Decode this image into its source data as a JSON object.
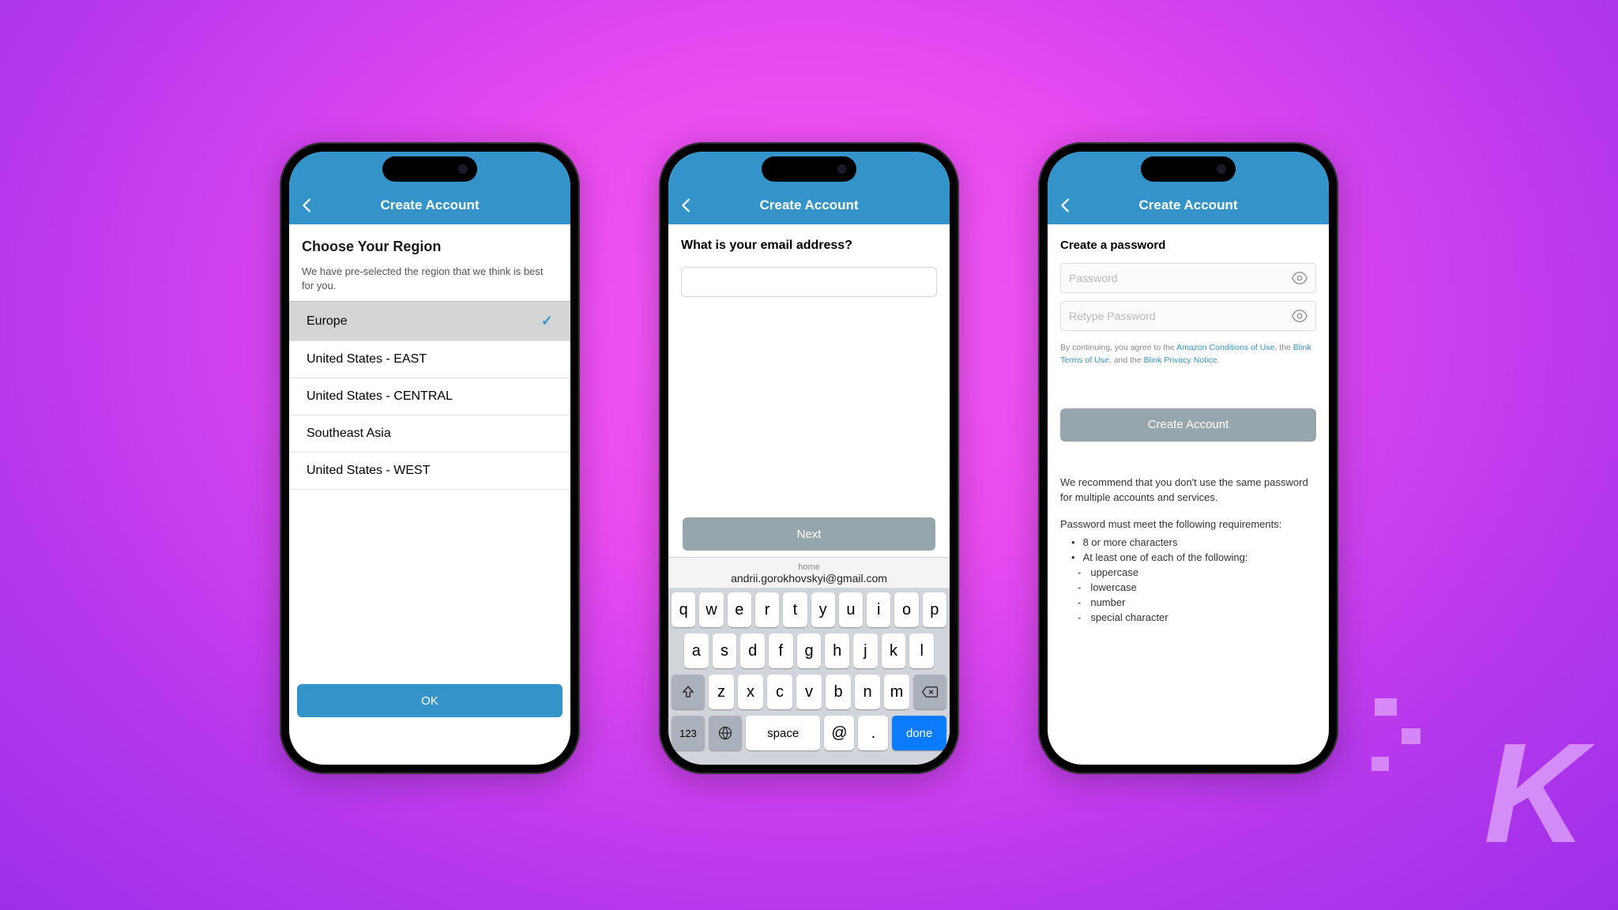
{
  "phone1": {
    "header_title": "Create Account",
    "h1": "Choose Your Region",
    "subtext": "We have pre-selected the region that we think is best for you.",
    "regions": [
      {
        "label": "Europe",
        "selected": true
      },
      {
        "label": "United States - EAST",
        "selected": false
      },
      {
        "label": "United States - CENTRAL",
        "selected": false
      },
      {
        "label": "Southeast Asia",
        "selected": false
      },
      {
        "label": "United States - WEST",
        "selected": false
      }
    ],
    "ok_label": "OK"
  },
  "phone2": {
    "header_title": "Create Account",
    "prompt": "What is your email address?",
    "email_value": "",
    "suggestion_label": "home",
    "suggestion_value": "andrii.gorokhovskyi@gmail.com",
    "next_label": "Next",
    "keyboard": {
      "row1": [
        "q",
        "w",
        "e",
        "r",
        "t",
        "y",
        "u",
        "i",
        "o",
        "p"
      ],
      "row2": [
        "a",
        "s",
        "d",
        "f",
        "g",
        "h",
        "j",
        "k",
        "l"
      ],
      "row3": [
        "z",
        "x",
        "c",
        "v",
        "b",
        "n",
        "m"
      ],
      "num_key": "123",
      "space_key": "space",
      "at_key": "@",
      "dot_key": ".",
      "done_key": "done"
    }
  },
  "phone3": {
    "header_title": "Create Account",
    "h1": "Create a password",
    "password_placeholder": "Password",
    "retype_placeholder": "Retype Password",
    "legal_prefix": "By continuing, you agree to the ",
    "legal_link1": "Amazon Conditions of Use",
    "legal_mid1": ", the ",
    "legal_link2": "Blink Terms of Use",
    "legal_mid2": ", and the ",
    "legal_link3": "Blink Privacy Notice",
    "legal_suffix": ".",
    "create_label": "Create Account",
    "recommend_text": "We recommend that you don't use the same password for multiple accounts and services.",
    "req_title": "Password must meet the following requirements:",
    "req1": "8 or more characters",
    "req2": "At least one of each of the following:",
    "sub1": "uppercase",
    "sub2": "lowercase",
    "sub3": "number",
    "sub4": "special character"
  }
}
